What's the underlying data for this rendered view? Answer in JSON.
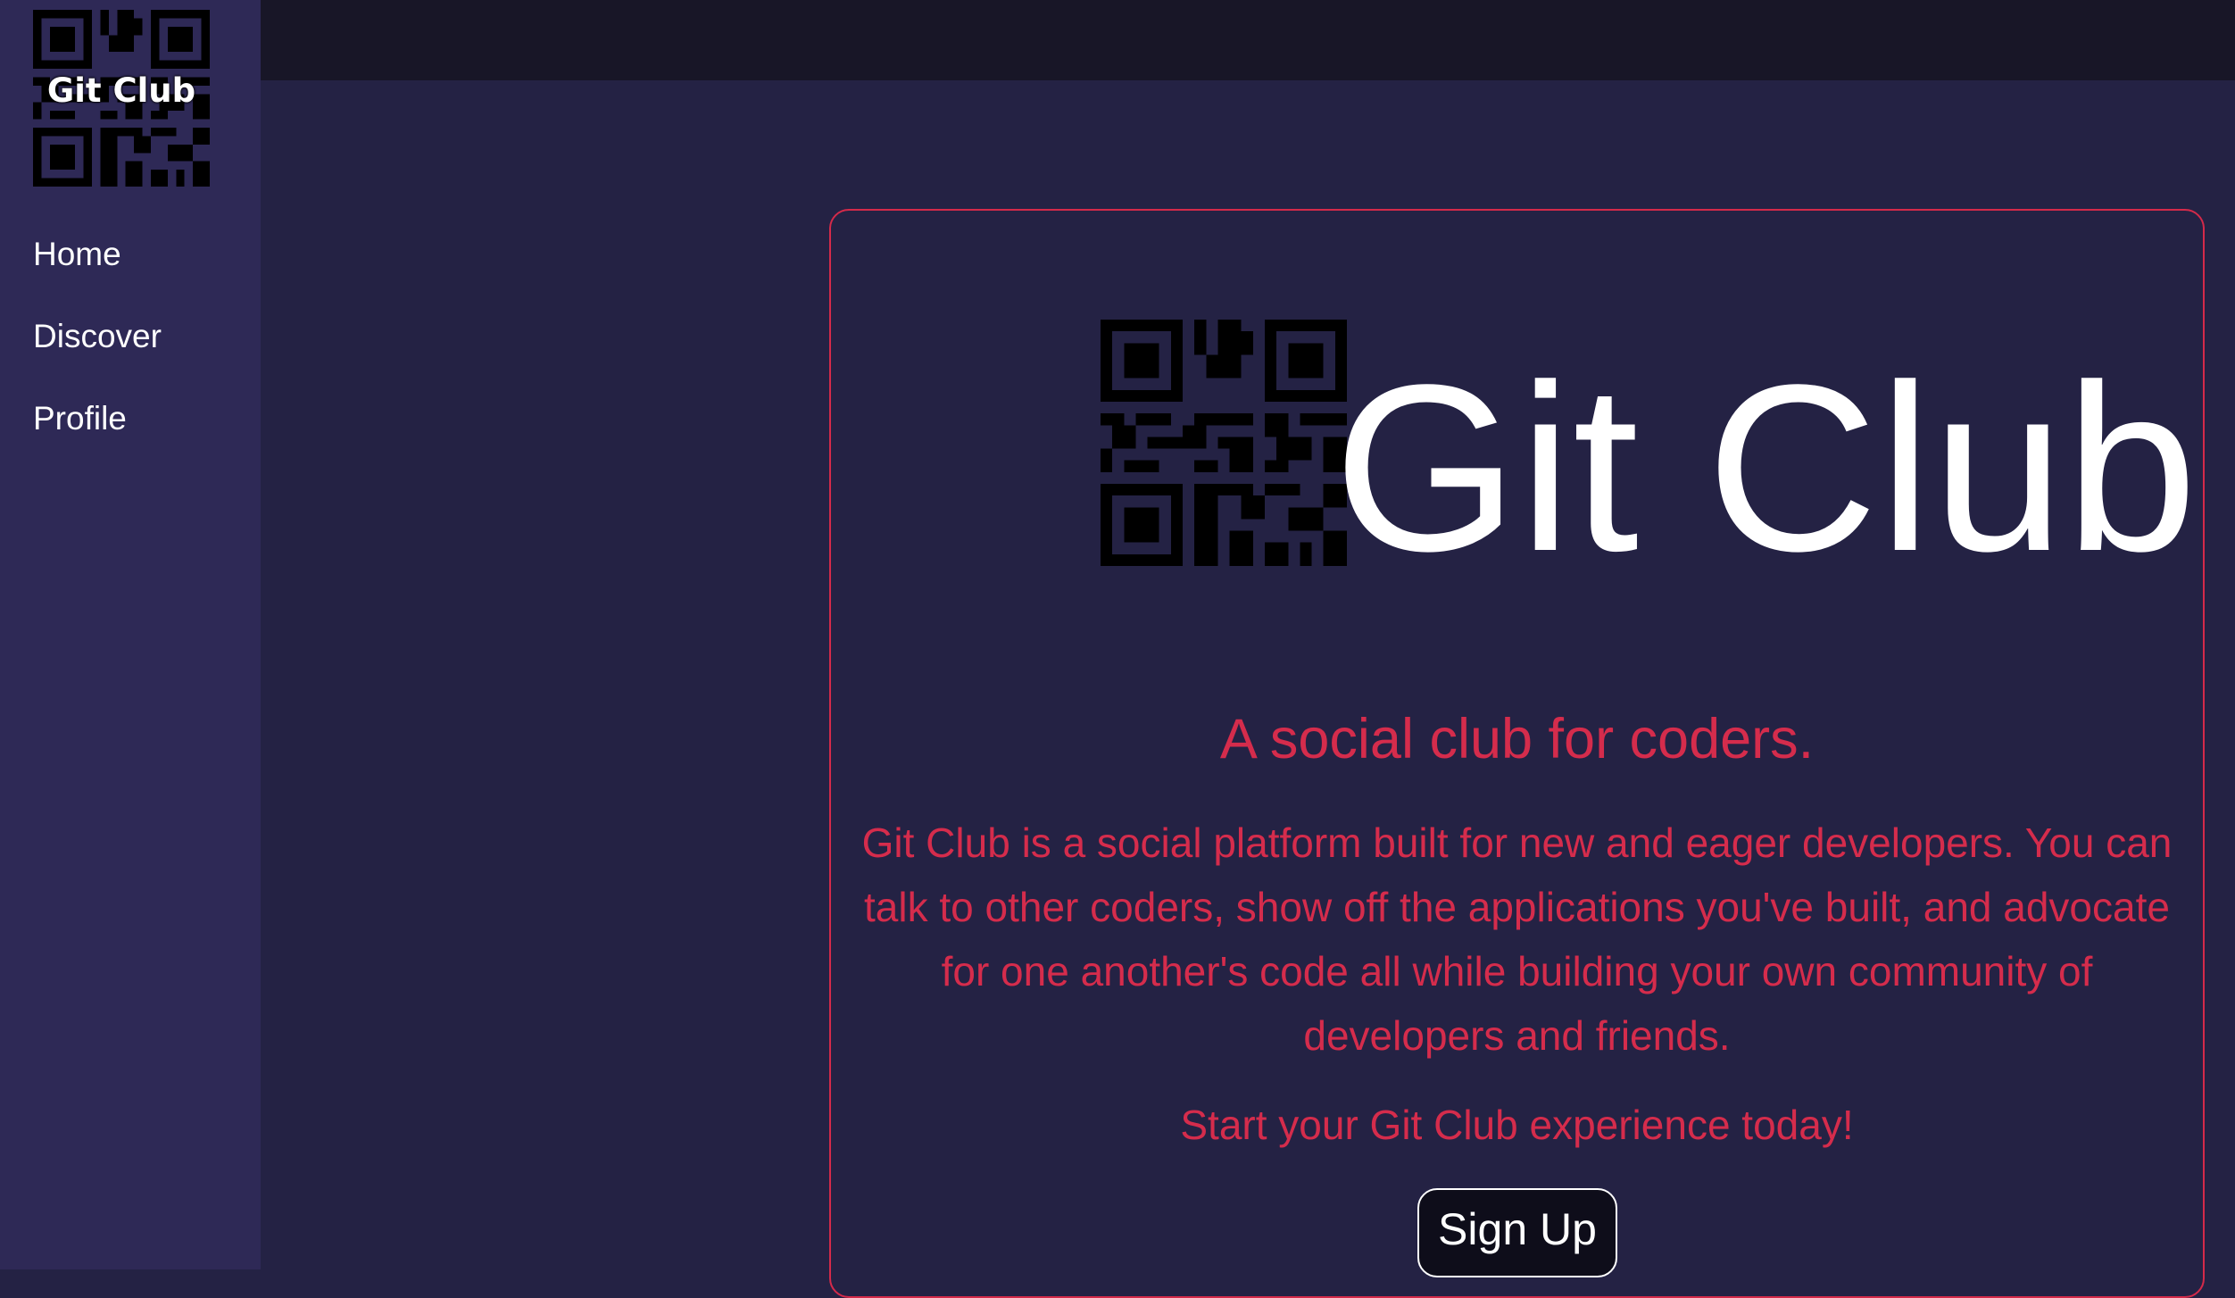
{
  "sidebar": {
    "logo_text": "Git Club",
    "logo_icon": "qr-code-icon",
    "items": [
      {
        "label": "Home"
      },
      {
        "label": "Discover"
      },
      {
        "label": "Profile"
      }
    ]
  },
  "hero": {
    "title": "Git Club",
    "logo_icon": "qr-code-icon",
    "tagline": "A social club for coders.",
    "description": "Git Club is a social platform built for new and eager developers. You can talk to other coders, show off the applications you've built, and advocate for one another's code all while building your own community of developers and friends.",
    "cta_text": "Start your Git Club experience today!",
    "signup_label": "Sign Up"
  },
  "colors": {
    "background": "#242244",
    "sidebar": "#2e2956",
    "topbar": "#181627",
    "accent": "#d52c4c",
    "text": "#ffffff"
  }
}
